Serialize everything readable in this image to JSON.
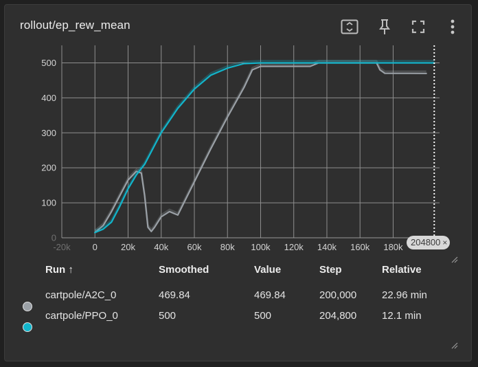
{
  "card": {
    "title": "rollout/ep_rew_mean"
  },
  "toolbar": {
    "fit_icon": "fit-domain-icon",
    "pin_icon": "pin-icon",
    "fullscreen_icon": "fullscreen-icon",
    "more_icon": "more-vert-icon"
  },
  "chart_data": {
    "type": "line",
    "title": "rollout/ep_rew_mean",
    "xlabel": "",
    "ylabel": "",
    "x_ticks": [
      "-20k",
      "0",
      "20k",
      "40k",
      "60k",
      "80k",
      "100k",
      "120k",
      "140k",
      "160k",
      "180k"
    ],
    "y_ticks": [
      "0",
      "100",
      "200",
      "300",
      "400",
      "500"
    ],
    "xlim": [
      -20000,
      208000
    ],
    "ylim": [
      0,
      550
    ],
    "grid": true,
    "cursor_step": 204800,
    "series": [
      {
        "name": "cartpole/A2C_0",
        "color": "#9aa0a6",
        "x": [
          0,
          5000,
          10000,
          15000,
          20000,
          25000,
          28000,
          30000,
          32000,
          34000,
          36000,
          40000,
          45000,
          50000,
          60000,
          70000,
          80000,
          90000,
          95000,
          100000,
          110000,
          120000,
          130000,
          135000,
          140000,
          150000,
          160000,
          170000,
          172000,
          175000,
          180000,
          190000,
          200000
        ],
        "values": [
          15,
          35,
          75,
          120,
          165,
          190,
          185,
          120,
          30,
          18,
          30,
          60,
          75,
          65,
          160,
          255,
          345,
          430,
          480,
          490,
          490,
          490,
          490,
          500,
          500,
          500,
          500,
          500,
          480,
          470,
          470,
          470,
          469.84
        ]
      },
      {
        "name": "cartpole/PPO_0",
        "color": "#12b5cb",
        "x": [
          0,
          5000,
          10000,
          15000,
          20000,
          25000,
          30000,
          40000,
          50000,
          60000,
          70000,
          80000,
          90000,
          100000,
          120000,
          140000,
          160000,
          180000,
          200000,
          204800
        ],
        "values": [
          15,
          25,
          45,
          90,
          140,
          180,
          210,
          300,
          370,
          425,
          465,
          485,
          498,
          500,
          500,
          500,
          500,
          500,
          500,
          500
        ]
      }
    ]
  },
  "table": {
    "headers": {
      "run": "Run ↑",
      "smoothed": "Smoothed",
      "value": "Value",
      "step": "Step",
      "relative": "Relative"
    },
    "rows": [
      {
        "color": "#9aa0a6",
        "run": "cartpole/A2C_0",
        "smoothed": "469.84",
        "value": "469.84",
        "step": "200,000",
        "relative": "22.96 min"
      },
      {
        "color": "#12b5cb",
        "run": "cartpole/PPO_0",
        "smoothed": "500",
        "value": "500",
        "step": "204,800",
        "relative": "12.1 min"
      }
    ]
  },
  "badge": {
    "step": "204800",
    "close": "×"
  }
}
